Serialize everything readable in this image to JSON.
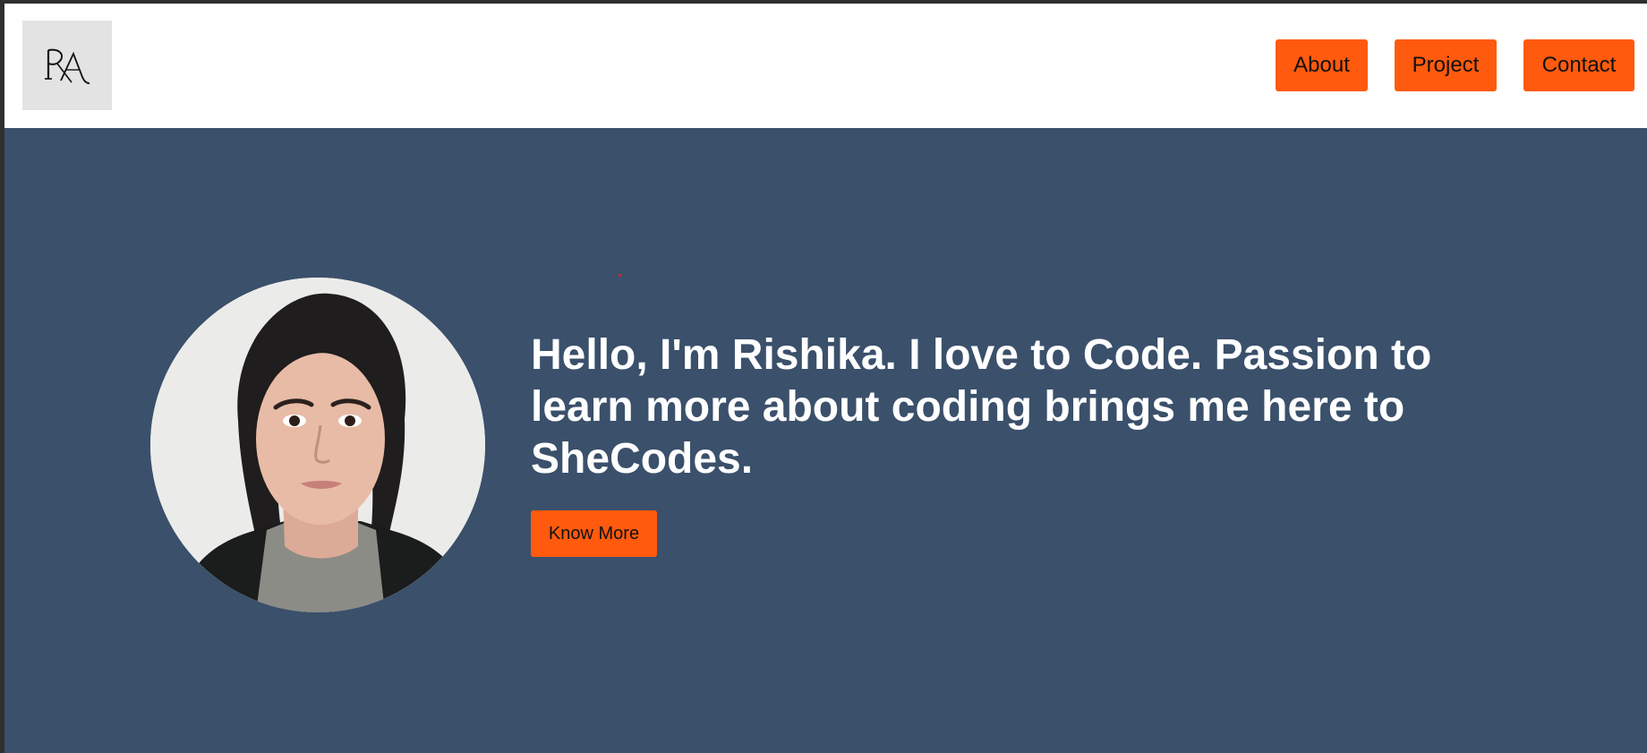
{
  "logo": {
    "text": "RA",
    "icon": "monogram-logo"
  },
  "nav": {
    "about_label": "About",
    "project_label": "Project",
    "contact_label": "Contact"
  },
  "hero": {
    "intro_text": "Hello, I'm Rishika. I love to Code. Passion to learn more about coding brings me here to SheCodes.",
    "cta_label": "Know More",
    "avatar_icon": "profile-photo"
  },
  "colors": {
    "accent": "#ff5a0e",
    "hero_background": "#3a506b",
    "header_background": "#ffffff",
    "logo_background": "#e3e3e3",
    "text_on_hero": "#ffffff"
  }
}
